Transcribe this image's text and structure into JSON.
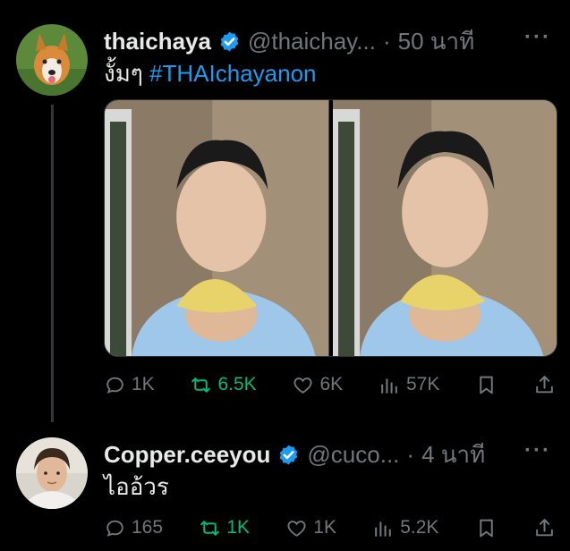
{
  "tweet": {
    "display_name": "thaichaya",
    "handle": "@thaichay...",
    "separator": "·",
    "time": "50 นาที",
    "more": "···",
    "text": "งั้มๆ",
    "hashtag": "#THAIchayanon",
    "stats": {
      "replies": "1K",
      "retweets": "6.5K",
      "likes": "6K",
      "views": "57K"
    }
  },
  "reply": {
    "display_name": "Copper.ceeyou",
    "handle": "@cuco...",
    "separator": "·",
    "time": "4 นาที",
    "more": "···",
    "text": "ไออ้วร",
    "stats": {
      "replies": "165",
      "retweets": "1K",
      "likes": "1K",
      "views": "5.2K"
    }
  },
  "colors": {
    "accent": "#1d9bf0",
    "retweet": "#00ba7c",
    "muted": "#71767b",
    "verified": "#1d9bf0"
  },
  "icons": [
    "verified-badge-icon",
    "reply-icon",
    "retweet-icon",
    "like-icon",
    "views-icon",
    "bookmark-icon",
    "share-icon",
    "more-icon"
  ]
}
